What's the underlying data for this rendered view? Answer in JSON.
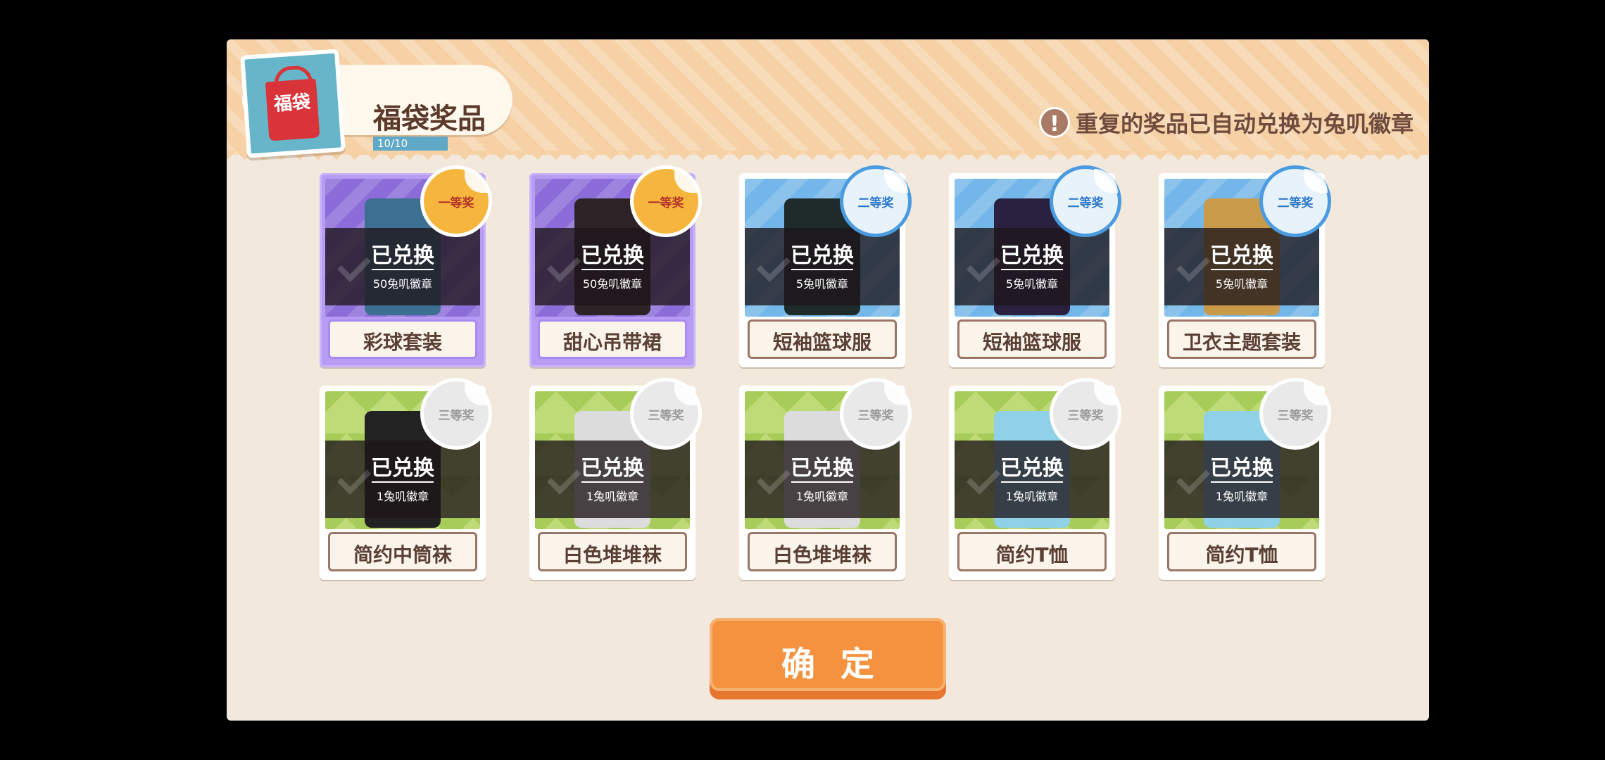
{
  "header": {
    "title": "福袋奖品",
    "progress_text": "10/10",
    "progress_fraction": 1.0,
    "bag_text": "福袋",
    "notice_icon": "exclamation-icon",
    "notice_text": "重复的奖品已自动兑换为兔叽徽章"
  },
  "prizes": [
    {
      "name": "彩球套装",
      "tier": "一等奖",
      "status": "已兑换",
      "cost": "50兔叽徽章",
      "theme": "purple",
      "clothes_color": "#3d6f92"
    },
    {
      "name": "甜心吊带裙",
      "tier": "一等奖",
      "status": "已兑换",
      "cost": "50兔叽徽章",
      "theme": "purple",
      "clothes_color": "#2b2326"
    },
    {
      "name": "短袖篮球服",
      "tier": "二等奖",
      "status": "已兑换",
      "cost": "5兔叽徽章",
      "theme": "blue",
      "clothes_color": "#1f2a2a"
    },
    {
      "name": "短袖篮球服",
      "tier": "二等奖",
      "status": "已兑换",
      "cost": "5兔叽徽章",
      "theme": "blue",
      "clothes_color": "#2a2040"
    },
    {
      "name": "卫衣主题套装",
      "tier": "二等奖",
      "status": "已兑换",
      "cost": "5兔叽徽章",
      "theme": "blue",
      "clothes_color": "#c89a4a"
    },
    {
      "name": "简约中筒袜",
      "tier": "三等奖",
      "status": "已兑换",
      "cost": "1兔叽徽章",
      "theme": "green",
      "clothes_color": "#222222"
    },
    {
      "name": "白色堆堆袜",
      "tier": "三等奖",
      "status": "已兑换",
      "cost": "1兔叽徽章",
      "theme": "green",
      "clothes_color": "#dcdcdc"
    },
    {
      "name": "白色堆堆袜",
      "tier": "三等奖",
      "status": "已兑换",
      "cost": "1兔叽徽章",
      "theme": "green",
      "clothes_color": "#dcdcdc"
    },
    {
      "name": "简约T恤",
      "tier": "三等奖",
      "status": "已兑换",
      "cost": "1兔叽徽章",
      "theme": "green",
      "clothes_color": "#8fd1e6"
    },
    {
      "name": "简约T恤",
      "tier": "三等奖",
      "status": "已兑换",
      "cost": "1兔叽徽章",
      "theme": "green",
      "clothes_color": "#8fd1e6"
    }
  ],
  "confirm_label": "确定"
}
